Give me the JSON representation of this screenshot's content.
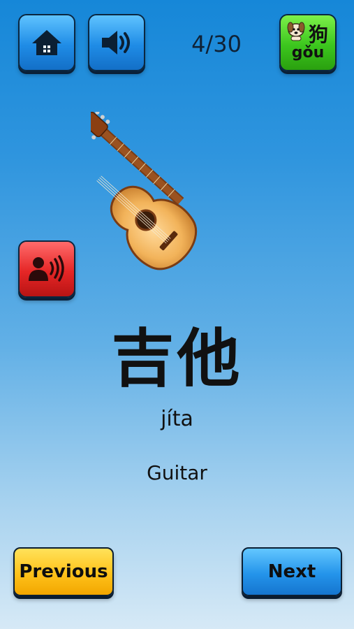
{
  "header": {
    "counter": "4/30"
  },
  "buttons": {
    "home_icon": "home-icon",
    "sound_icon": "speaker-icon",
    "language_char": "狗",
    "language_pinyin": "gǒu",
    "speak_icon": "speaker-person-icon",
    "previous_label": "Previous",
    "next_label": "Next"
  },
  "card": {
    "image": "guitar",
    "hanzi": "吉他",
    "pinyin": "jíta",
    "english": "Guitar"
  },
  "colors": {
    "accent_blue": "#1f8ce6",
    "accent_green": "#3cc61e",
    "accent_red": "#e52626",
    "accent_yellow": "#ffc21a"
  }
}
